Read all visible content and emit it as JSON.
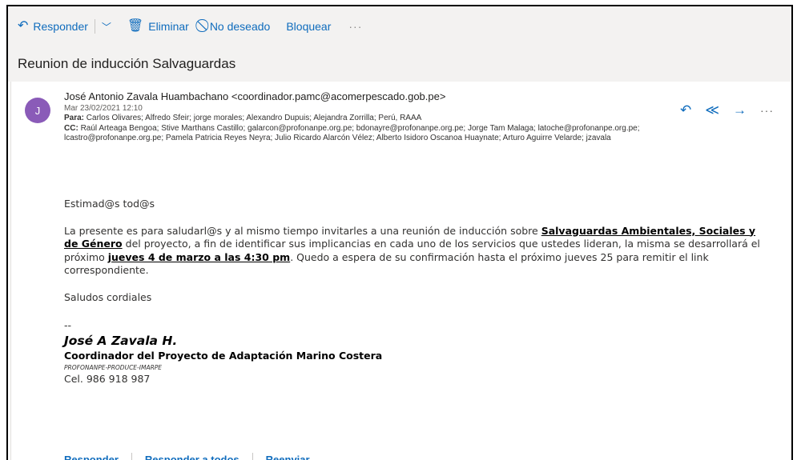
{
  "toolbar": {
    "reply_label": "Responder",
    "delete_label": "Eliminar",
    "junk_label": "No deseado",
    "block_label": "Bloquear",
    "more_label": "···"
  },
  "subject": "Reunion de inducción Salvaguardas",
  "message": {
    "avatar_initial": "J",
    "from_line": "José Antonio Zavala Huambachano <coordinador.pamc@acomerpescado.gob.pe>",
    "date": "Mar 23/02/2021 12:10",
    "to_label": "Para:",
    "to": "Carlos Olivares; Alfredo Sfeir; jorge morales; Alexandro Dupuis; Alejandra Zorrilla; Perú, RAAA",
    "cc_label": "CC:",
    "cc": "Raúl Arteaga Bengoa; Stive Marthans Castillo; galarcon@profonanpe.org.pe; bdonayre@profonanpe.org.pe; Jorge Tam Malaga; latoche@profonanpe.org.pe; lcastro@profonanpe.org.pe; Pamela Patricia Reyes Neyra; Julio Ricardo Alarcón Vélez; Alberto Isidoro Oscanoa Huaynate; Arturo Aguirre Velarde; jzavala"
  },
  "body": {
    "greeting": "Estimad@s tod@s",
    "p1_a": "La presente es para saludarl@s y al mismo tiempo invitarles a una reunión de inducción sobre ",
    "p1_link": "Salvaguardas Ambientales, Sociales y de Género",
    "p1_b": " del proyecto, a fin de identificar sus implicancias en cada uno de los servicios que ustedes lideran, la misma se desarrollará el próximo ",
    "p1_date": "jueves 4 de marzo a las 4:30 pm",
    "p1_c": ". Quedo a espera de su confirmación hasta el próximo jueves 25 para remitir el link correspondiente.",
    "closing": "Saludos cordiales"
  },
  "signature": {
    "dash": "--",
    "name": "José A Zavala H.",
    "title": "Coordinador del Proyecto de Adaptación Marino Costera",
    "org": "PROFONANPE-PRODUCE-IMARPE",
    "phone": "Cel. 986 918 987"
  },
  "footer": {
    "reply_label": "Responder",
    "reply_all_label": "Responder a todos",
    "forward_label": "Reenviar"
  }
}
